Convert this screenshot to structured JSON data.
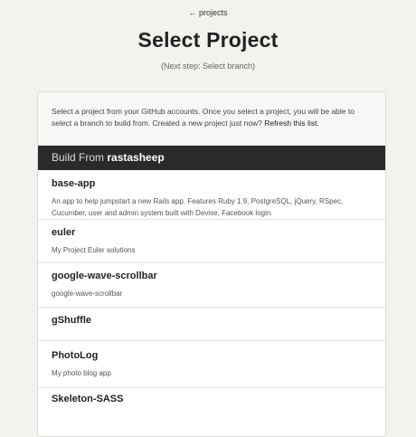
{
  "header": {
    "back_link": "← projects",
    "title": "Select Project",
    "next_step": "(Next step: Select branch)"
  },
  "intro": {
    "text": "Select a project from your GitHub accounts. Once you select a project, you will be able to select a branch to build from. Created a new project just now? ",
    "refresh_link": "Refresh this list."
  },
  "build_bar": {
    "prefix": "Build From",
    "user": "rastasheep"
  },
  "projects": [
    {
      "name": "base-app",
      "description": "An app to help jumpstart a new Rails app. Features Ruby 1.9, PostgreSQL, jQuery, RSpec, Cucumber, user and admin system built with Devise, Facebook login."
    },
    {
      "name": "euler",
      "description": "My Project Euler solutions"
    },
    {
      "name": "google-wave-scrollbar",
      "description": "google-wave-scrollbar"
    },
    {
      "name": "gShuffle",
      "description": ""
    },
    {
      "name": "PhotoLog",
      "description": "My photo blog app"
    },
    {
      "name": "Skeleton-SASS",
      "description": ""
    }
  ]
}
